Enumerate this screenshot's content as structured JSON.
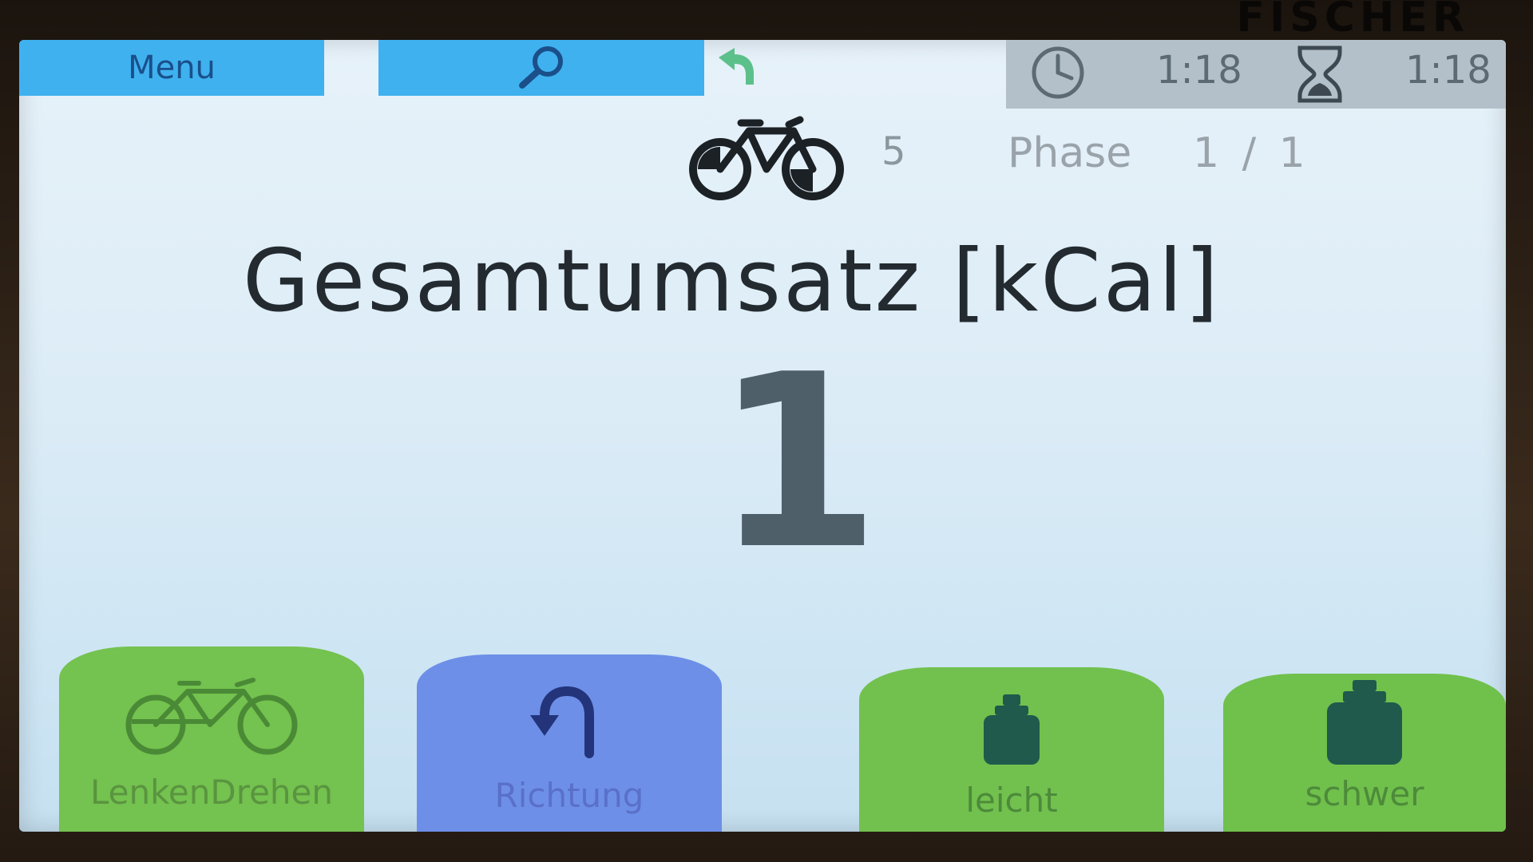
{
  "brand": "FISCHER",
  "topbar": {
    "menu_label": "Menu",
    "elapsed_time": "1:18",
    "remaining_time": "1:18"
  },
  "status": {
    "bike_count": "5",
    "phase_label": "Phase",
    "phase_value": "1 / 1"
  },
  "main": {
    "title": "Gesamtumsatz [kCal]",
    "value": "1"
  },
  "buttons": {
    "lenken_label": "LenkenDrehen",
    "richtung_label": "Richtung",
    "leicht_label": "leicht",
    "schwer_label": "schwer"
  },
  "colors": {
    "top_button": "#3fb1ef",
    "green_button": "#74c24f",
    "blue_button": "#6d8fe8",
    "time_panel": "#b3c0c9"
  },
  "icons": {
    "search": "search-icon",
    "back": "back-arrow-icon",
    "clock": "clock-icon",
    "hourglass": "hourglass-icon",
    "bike": "bike-icon",
    "u-turn": "u-turn-icon",
    "weight-light": "weight-icon",
    "weight-heavy": "heavy-weight-icon"
  }
}
